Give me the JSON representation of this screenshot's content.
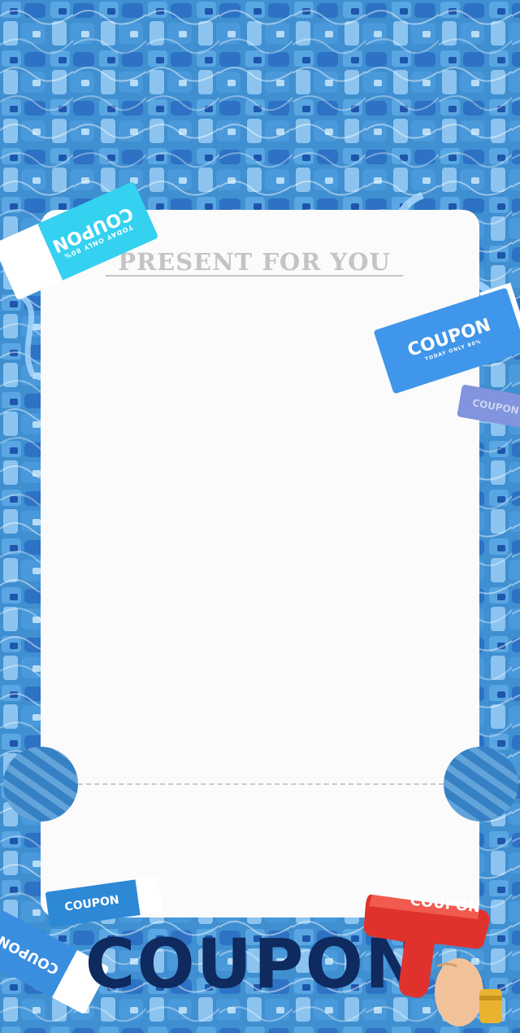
{
  "banner": {
    "title": "PRESENT FOR YOU"
  },
  "coupons": {
    "top_left": {
      "main": "COUPON",
      "sub": "TODAY ONLY 80%"
    },
    "right": {
      "main": "COUPON",
      "sub": "TODAY ONLY 80%"
    },
    "right_small": {
      "main": "COUPON"
    },
    "bottom_left_small": {
      "main": "COUPON"
    },
    "bottom_left": {
      "main": "COUPON"
    },
    "gun": {
      "main": "COUPON"
    }
  },
  "footer": {
    "big_text": "COUPON"
  },
  "colors": {
    "background_water": "#3f8fd1",
    "card": "#fbfbfb",
    "title_gray": "#c4c4c4",
    "cyan_ticket": "#34d1f0",
    "blue_ticket": "#3f96ea",
    "navy_text": "#0f2a5e",
    "gun_red": "#e0322d"
  }
}
